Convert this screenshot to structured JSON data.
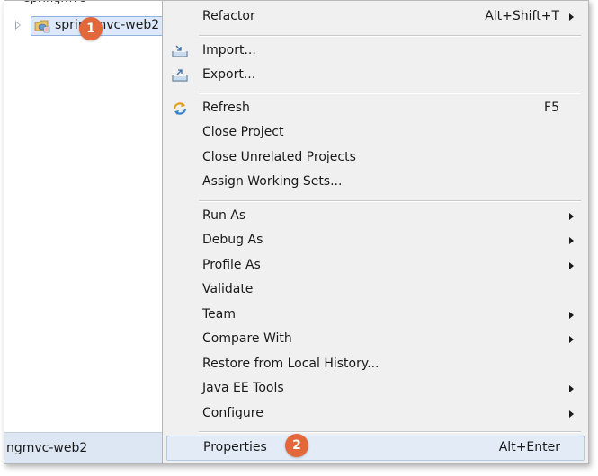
{
  "explorer": {
    "partial_item": "springmvc",
    "project_label": "springmvc-web2",
    "status_label": "ngmvc-web2"
  },
  "menu": {
    "items": [
      {
        "label": "Refactor",
        "shortcut": "Alt+Shift+T"
      },
      {
        "label": "Import..."
      },
      {
        "label": "Export..."
      },
      {
        "label": "Refresh",
        "shortcut": "F5"
      },
      {
        "label": "Close Project"
      },
      {
        "label": "Close Unrelated Projects"
      },
      {
        "label": "Assign Working Sets..."
      },
      {
        "label": "Run As"
      },
      {
        "label": "Debug As"
      },
      {
        "label": "Profile As"
      },
      {
        "label": "Validate"
      },
      {
        "label": "Team"
      },
      {
        "label": "Compare With"
      },
      {
        "label": "Restore from Local History..."
      },
      {
        "label": "Java EE Tools"
      },
      {
        "label": "Configure"
      },
      {
        "label": "Properties",
        "shortcut": "Alt+Enter"
      }
    ]
  },
  "callouts": [
    "1",
    "2"
  ],
  "icons": {
    "project": "java-web-project-icon",
    "import": "import-icon",
    "export": "export-icon",
    "refresh": "refresh-icon"
  },
  "colors": {
    "callout": "#e2683c",
    "selection": "#dde9fb",
    "menu_background": "#f0f0f0",
    "highlight": "#e3ecf6"
  }
}
